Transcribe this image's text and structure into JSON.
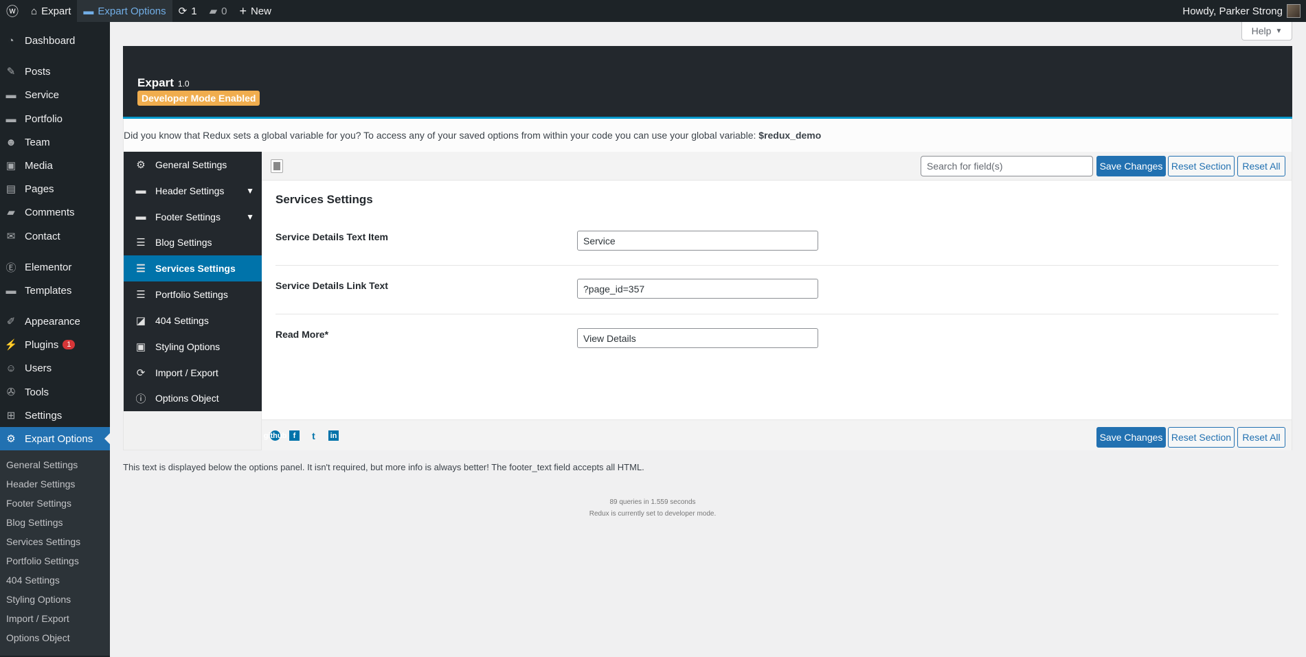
{
  "adminbar": {
    "site": "Expart",
    "options": "Expart Options",
    "updates": "1",
    "comments": "0",
    "new": "New",
    "howdy": "Howdy, Parker Strong"
  },
  "sidebar": {
    "items": [
      {
        "label": "Dashboard",
        "icon": "dashboard-icon",
        "glyph": "◔"
      },
      {
        "label": "Posts",
        "icon": "pin-icon",
        "glyph": "✎"
      },
      {
        "label": "Service",
        "icon": "folder-icon",
        "glyph": "▬"
      },
      {
        "label": "Portfolio",
        "icon": "folder-icon",
        "glyph": "▬"
      },
      {
        "label": "Team",
        "icon": "team-icon",
        "glyph": "☻"
      },
      {
        "label": "Media",
        "icon": "media-icon",
        "glyph": "▣"
      },
      {
        "label": "Pages",
        "icon": "pages-icon",
        "glyph": "▤"
      },
      {
        "label": "Comments",
        "icon": "comment-icon",
        "glyph": "▰"
      },
      {
        "label": "Contact",
        "icon": "mail-icon",
        "glyph": "✉"
      },
      {
        "label": "Elementor",
        "icon": "elementor-icon",
        "glyph": "Ⓔ"
      },
      {
        "label": "Templates",
        "icon": "folder-open-icon",
        "glyph": "▬"
      },
      {
        "label": "Appearance",
        "icon": "brush-icon",
        "glyph": "✐"
      },
      {
        "label": "Plugins",
        "icon": "plugin-icon",
        "glyph": "⚡",
        "badge": "1"
      },
      {
        "label": "Users",
        "icon": "user-icon",
        "glyph": "☺"
      },
      {
        "label": "Tools",
        "icon": "wrench-icon",
        "glyph": "✇"
      },
      {
        "label": "Settings",
        "icon": "settings-icon",
        "glyph": "⊞"
      },
      {
        "label": "Expart Options",
        "icon": "gear-icon",
        "glyph": "⚙"
      }
    ],
    "submenu": [
      "General Settings",
      "Header Settings",
      "Footer Settings",
      "Blog Settings",
      "Services Settings",
      "Portfolio Settings",
      "404 Settings",
      "Styling Options",
      "Import / Export",
      "Options Object"
    ]
  },
  "help": "Help",
  "redux": {
    "title": "Expart",
    "version": "1.0",
    "dev_badge": "Developer Mode Enabled",
    "info": "Did you know that Redux sets a global variable for you? To access any of your saved options from within your code you can use your global variable:",
    "info_var": "$redux_demo",
    "nav": [
      {
        "label": "General Settings",
        "glyph": "⚙"
      },
      {
        "label": "Header Settings",
        "glyph": "▬",
        "chev": true
      },
      {
        "label": "Footer Settings",
        "glyph": "▬",
        "chev": true
      },
      {
        "label": "Blog Settings",
        "glyph": "☰"
      },
      {
        "label": "Services Settings",
        "glyph": "☰",
        "active": true
      },
      {
        "label": "Portfolio Settings",
        "glyph": "☰"
      },
      {
        "label": "404 Settings",
        "glyph": "◪"
      },
      {
        "label": "Styling Options",
        "glyph": "▣"
      },
      {
        "label": "Import / Export",
        "glyph": "⟳"
      },
      {
        "label": "Options Object",
        "glyph": "ⓘ"
      }
    ],
    "search_placeholder": "Search for field(s)",
    "save": "Save Changes",
    "reset_section": "Reset Section",
    "reset_all": "Reset All",
    "section_title": "Services Settings",
    "fields": [
      {
        "label": "Service Details Text Item",
        "value": "Service"
      },
      {
        "label": "Service Details Link Text",
        "value": "?page_id=357"
      },
      {
        "label": "Read More*",
        "value": "View Details"
      }
    ],
    "social": [
      "github",
      "f",
      "t",
      "in"
    ]
  },
  "footer_text": "This text is displayed below the options panel. It isn't required, but more info is always better! The footer_text field accepts all HTML.",
  "stats": {
    "queries": "89 queries in 1.559 seconds",
    "mode": "Redux is currently set to developer mode."
  }
}
